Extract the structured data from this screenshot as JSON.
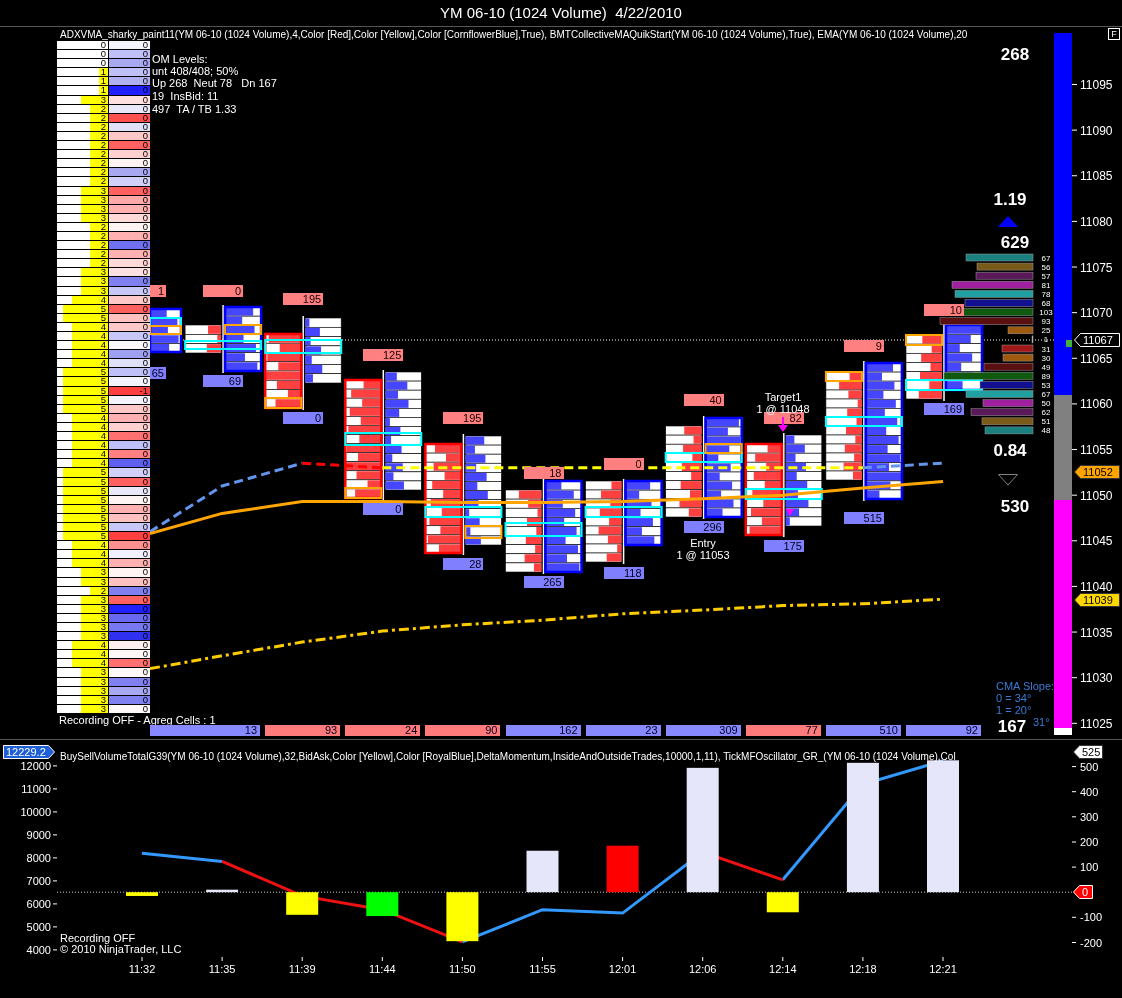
{
  "window": {
    "title": "YM 06-10 (1024 Volume)  4/22/2010"
  },
  "price_panel": {
    "indicator_label": "ADXVMA_sharky_paint11(YM 06-10 (1024 Volume),4,Color [Red],Color [Yellow],Color [CornflowerBlue],True), BMTCollectiveMAQuikStart(YM 06-10 (1024 Volume),True), EMA(YM 06-10 (1024 Volume),20",
    "corner_button": "F",
    "dom_info": [
      "OM Levels:",
      "unt 408/408; 50%",
      "Up 268  Neut 78   Dn 167",
      "19  InsBid: 11",
      "497  TA / TB 1.33"
    ],
    "ladder": [
      {
        "volume": "0",
        "delta": "0",
        "color": "#f4f4ff"
      },
      {
        "volume": "0",
        "delta": "0",
        "color": "#c0c0f8"
      },
      {
        "volume": "0",
        "delta": "0",
        "color": "#a8a8f0"
      },
      {
        "volume": "1",
        "delta": "0",
        "color": "#c0c0f8"
      },
      {
        "volume": "1",
        "delta": "0",
        "color": "#b0b0f0"
      },
      {
        "volume": "1",
        "delta": "0",
        "color": "#2020ff"
      },
      {
        "volume": "3",
        "delta": "0",
        "color": "#ffe0e0"
      },
      {
        "volume": "2",
        "delta": "0",
        "color": "#e8e8f8"
      },
      {
        "volume": "2",
        "delta": "0",
        "color": "#ff5050"
      },
      {
        "volume": "2",
        "delta": "0",
        "color": "#e0e0f8"
      },
      {
        "volume": "2",
        "delta": "0",
        "color": "#ffc8c8"
      },
      {
        "volume": "2",
        "delta": "0",
        "color": "#ff6060"
      },
      {
        "volume": "2",
        "delta": "0",
        "color": "#ffd0d0"
      },
      {
        "volume": "2",
        "delta": "0",
        "color": "#fff4f4"
      },
      {
        "volume": "2",
        "delta": "0",
        "color": "#a8a8f0"
      },
      {
        "volume": "2",
        "delta": "0",
        "color": "#d0d0f8"
      },
      {
        "volume": "3",
        "delta": "0",
        "color": "#ff6060"
      },
      {
        "volume": "3",
        "delta": "0",
        "color": "#ffa8a8"
      },
      {
        "volume": "3",
        "delta": "0",
        "color": "#ffb0b0"
      },
      {
        "volume": "3",
        "delta": "0",
        "color": "#ffd8d8"
      },
      {
        "volume": "2",
        "delta": "0",
        "color": "#fff4f4"
      },
      {
        "volume": "2",
        "delta": "0",
        "color": "#ffb0b0"
      },
      {
        "volume": "2",
        "delta": "0",
        "color": "#7070f0"
      },
      {
        "volume": "2",
        "delta": "0",
        "color": "#ffb0b0"
      },
      {
        "volume": "2",
        "delta": "0",
        "color": "#ffd8d8"
      },
      {
        "volume": "3",
        "delta": "0",
        "color": "#ffe0e0"
      },
      {
        "volume": "3",
        "delta": "0",
        "color": "#8080f0"
      },
      {
        "volume": "3",
        "delta": "0",
        "color": "#c8c8f8"
      },
      {
        "volume": "4",
        "delta": "0",
        "color": "#ffc8c8"
      },
      {
        "volume": "5",
        "delta": "0",
        "color": "#ff6060"
      },
      {
        "volume": "5",
        "delta": "0",
        "color": "#ffc0c0"
      },
      {
        "volume": "4",
        "delta": "0",
        "color": "#ffc8c8"
      },
      {
        "volume": "4",
        "delta": "0",
        "color": "#c8c8f8"
      },
      {
        "volume": "4",
        "delta": "0",
        "color": "#f8f8ff"
      },
      {
        "volume": "4",
        "delta": "0",
        "color": "#a0a0f0"
      },
      {
        "volume": "4",
        "delta": "0",
        "color": "#e0e0f8"
      },
      {
        "volume": "5",
        "delta": "0",
        "color": "#c0c0f8"
      },
      {
        "volume": "5",
        "delta": "0",
        "color": "#f4f4ff"
      },
      {
        "volume": "5",
        "delta": "-1",
        "color": "#ff4040"
      },
      {
        "volume": "5",
        "delta": "0",
        "color": "#f4f4ff"
      },
      {
        "volume": "5",
        "delta": "0",
        "color": "#ffc8c8"
      },
      {
        "volume": "4",
        "delta": "0",
        "color": "#ffb0b0"
      },
      {
        "volume": "4",
        "delta": "0",
        "color": "#ffd0d0"
      },
      {
        "volume": "4",
        "delta": "0",
        "color": "#ff7070"
      },
      {
        "volume": "4",
        "delta": "0",
        "color": "#c0c0f8"
      },
      {
        "volume": "4",
        "delta": "0",
        "color": "#ff8080"
      },
      {
        "volume": "4",
        "delta": "0",
        "color": "#6060f0"
      },
      {
        "volume": "5",
        "delta": "0",
        "color": "#d0d0f8"
      },
      {
        "volume": "5",
        "delta": "0",
        "color": "#ff6060"
      },
      {
        "volume": "5",
        "delta": "0",
        "color": "#e8e8f8"
      },
      {
        "volume": "5",
        "delta": "0",
        "color": "#fff4f4"
      },
      {
        "volume": "5",
        "delta": "0",
        "color": "#ffb0b0"
      },
      {
        "volume": "5",
        "delta": "0",
        "color": "#ffc0c0"
      },
      {
        "volume": "5",
        "delta": "0",
        "color": "#c8c8f8"
      },
      {
        "volume": "5",
        "delta": "0",
        "color": "#ff4040"
      },
      {
        "volume": "4",
        "delta": "0",
        "color": "#ff9090"
      },
      {
        "volume": "4",
        "delta": "0",
        "color": "#f0f0ff"
      },
      {
        "volume": "4",
        "delta": "0",
        "color": "#ffb0b0"
      },
      {
        "volume": "3",
        "delta": "0",
        "color": "#fff4f4"
      },
      {
        "volume": "3",
        "delta": "0",
        "color": "#ffc0c0"
      },
      {
        "volume": "2",
        "delta": "0",
        "color": "#8080f0"
      },
      {
        "volume": "3",
        "delta": "0",
        "color": "#ff6060"
      },
      {
        "volume": "3",
        "delta": "0",
        "color": "#2020ff"
      },
      {
        "volume": "3",
        "delta": "0",
        "color": "#6868f0"
      },
      {
        "volume": "3",
        "delta": "0",
        "color": "#7878f0"
      },
      {
        "volume": "3",
        "delta": "0",
        "color": "#3030f0"
      },
      {
        "volume": "4",
        "delta": "0",
        "color": "#fff0f0"
      },
      {
        "volume": "4",
        "delta": "0",
        "color": "#fff8f8"
      },
      {
        "volume": "4",
        "delta": "0",
        "color": "#ff7070"
      },
      {
        "volume": "3",
        "delta": "0",
        "color": "#fff8f8"
      },
      {
        "volume": "3",
        "delta": "0",
        "color": "#8080f0"
      },
      {
        "volume": "3",
        "delta": "0",
        "color": "#a8a8f0"
      },
      {
        "volume": "3",
        "delta": "0",
        "color": "#8080f0"
      },
      {
        "volume": "3",
        "delta": "0",
        "color": "#fff8f8"
      }
    ],
    "recording_status": "Recording OFF - Agreg Cells : 1",
    "bars": [
      {
        "kind": "up",
        "top_label": "1",
        "bottom_label": "65"
      },
      {
        "kind": "up",
        "top_label": "0",
        "bottom_label": "69"
      },
      {
        "kind": "down",
        "top_label": "195",
        "bottom_label": "0"
      },
      {
        "kind": "down",
        "top_label": "125",
        "bottom_label": "0"
      },
      {
        "kind": "down",
        "top_label": "195",
        "bottom_label": "28"
      },
      {
        "kind": "up",
        "top_label": "18",
        "bottom_label": "265"
      },
      {
        "kind": "up",
        "top_label": "0",
        "bottom_label": "118"
      },
      {
        "kind": "up",
        "top_label": "40",
        "bottom_label": "296"
      },
      {
        "kind": "down",
        "top_label": "82",
        "bottom_label": "175"
      },
      {
        "kind": "up",
        "top_label": "9",
        "bottom_label": "515"
      },
      {
        "kind": "up",
        "top_label": "10",
        "bottom_label": "169"
      }
    ],
    "volume_row": [
      {
        "text": "13",
        "color": "#8888ff"
      },
      {
        "text": "93",
        "color": "#ff7b7b"
      },
      {
        "text": "24",
        "color": "#ff7b7b"
      },
      {
        "text": "90",
        "color": "#ff7b7b"
      },
      {
        "text": "162",
        "color": "#8888ff"
      },
      {
        "text": "23",
        "color": "#8888ff"
      },
      {
        "text": "309",
        "color": "#8888ff"
      },
      {
        "text": "77",
        "color": "#ff7b7b"
      },
      {
        "text": "510",
        "color": "#8888ff"
      },
      {
        "text": "92",
        "color": "#8888ff"
      }
    ],
    "annotations": [
      {
        "title": "Target1",
        "detail": "1 @ 11048"
      },
      {
        "title": "Entry",
        "detail": "1 @ 11053"
      }
    ],
    "up_total": "268",
    "buy_ratio": "1.19",
    "buy_count": "629",
    "sell_ratio": "0.84",
    "sell_count": "530",
    "down_total": "167",
    "cma_slope": [
      "CMA Slope:",
      "0 = 34°",
      "1 = 20°",
      "31°"
    ],
    "volume_profile": [
      {
        "value": "67"
      },
      {
        "value": "56"
      },
      {
        "value": "57"
      },
      {
        "value": "81"
      },
      {
        "value": "78"
      },
      {
        "value": "68"
      },
      {
        "value": "103"
      },
      {
        "value": "93"
      },
      {
        "value": "25"
      },
      {
        "value": "1"
      },
      {
        "value": "31"
      },
      {
        "value": "30"
      },
      {
        "value": "49"
      },
      {
        "value": "89"
      },
      {
        "value": "53"
      },
      {
        "value": "67"
      },
      {
        "value": "50"
      },
      {
        "value": "62"
      },
      {
        "value": "51"
      },
      {
        "value": "48"
      }
    ],
    "price_markers": [
      {
        "label": "11067",
        "kind": "outline",
        "color": "#ffffff"
      },
      {
        "label": "11052",
        "kind": "filled",
        "color": "#ffa500"
      },
      {
        "label": "11039",
        "kind": "filled",
        "color": "#ffd700"
      }
    ],
    "price_axis": [
      "11095",
      "11090",
      "11085",
      "11080",
      "11075",
      "11070",
      "11065",
      "11060",
      "11055",
      "11050",
      "11045",
      "11040",
      "11035",
      "11030",
      "11025"
    ]
  },
  "lower_panel": {
    "indicator_label": "BuySellVolumeTotalG39(YM 06-10 (1024 Volume),32,BidAsk,Color [Yellow],Color [RoyalBlue],DeltaMomentum,InsideAndOutsideTrades,10000,1,11), TickMFOscillator_GR_(YM 06-10 (1024 Volume),Col",
    "recording_status": "Recording OFF",
    "copyright": "© 2010 NinjaTrader, LLC",
    "left_marker": {
      "label": "12229.2",
      "color": "#1e5fd8"
    },
    "right_markers": [
      {
        "label": "525",
        "color": "#ffffff"
      },
      {
        "label": "0",
        "color": "#ff0000"
      }
    ],
    "oscillator_axis": [
      "12000",
      "11000",
      "10000",
      "9000",
      "8000",
      "7000",
      "6000",
      "5000",
      "4000"
    ],
    "delta_axis": [
      "500",
      "400",
      "300",
      "200",
      "100",
      "-100",
      "-200"
    ],
    "time_axis": [
      "11:32",
      "11:35",
      "11:39",
      "11:44",
      "11:50",
      "11:55",
      "12:01",
      "12:06",
      "12:14",
      "12:18",
      "12:21"
    ]
  }
}
